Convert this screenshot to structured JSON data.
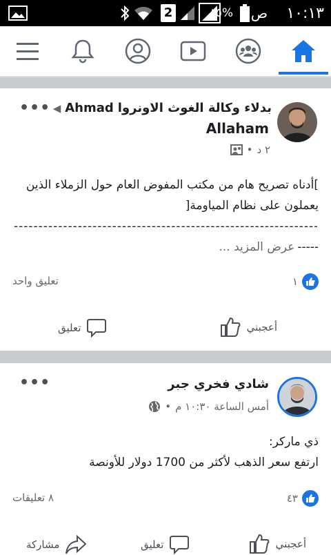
{
  "status_bar": {
    "time": "١٠:١٣",
    "ampm": "ص",
    "battery_pct": "٨٥%",
    "sim_slot": "2"
  },
  "nav": {
    "items": [
      "home",
      "groups",
      "watch",
      "profile",
      "notifications",
      "menu"
    ],
    "active": "home",
    "accent": "#1b74e4"
  },
  "posts": [
    {
      "author": "Ahmad Allaham",
      "group": "بدلاء وكالة الغوث الاونروا",
      "time": "٢ د",
      "privacy_icon": "group-icon",
      "text_line1": "]أدناه تصريح هام من مكتب المفوض العام حول الزملاء الذين",
      "text_line2": "يعملون على نظام المياومة[",
      "text_line3": "--------------------------------------------------------------",
      "text_line4_dash": "-----",
      "see_more": "... عرض المزيد",
      "like_count": "١",
      "comment_count": "تعليق واحد",
      "like_label": "أعجبني",
      "comment_label": "تعليق"
    },
    {
      "author": "شادي فخري جبر",
      "time": "أمس الساعة ١٠:٣٠ م",
      "privacy_icon": "globe-icon",
      "text_line1": "ذي ماركر:",
      "text_line2": "ارتفع سعر الذهب لأكثر من 1700 دولار للأونصة",
      "like_count": "٤٣",
      "comment_count": "٨ تعليقات",
      "like_label": "أعجبني",
      "comment_label": "تعليق",
      "share_label": "مشاركة"
    }
  ]
}
